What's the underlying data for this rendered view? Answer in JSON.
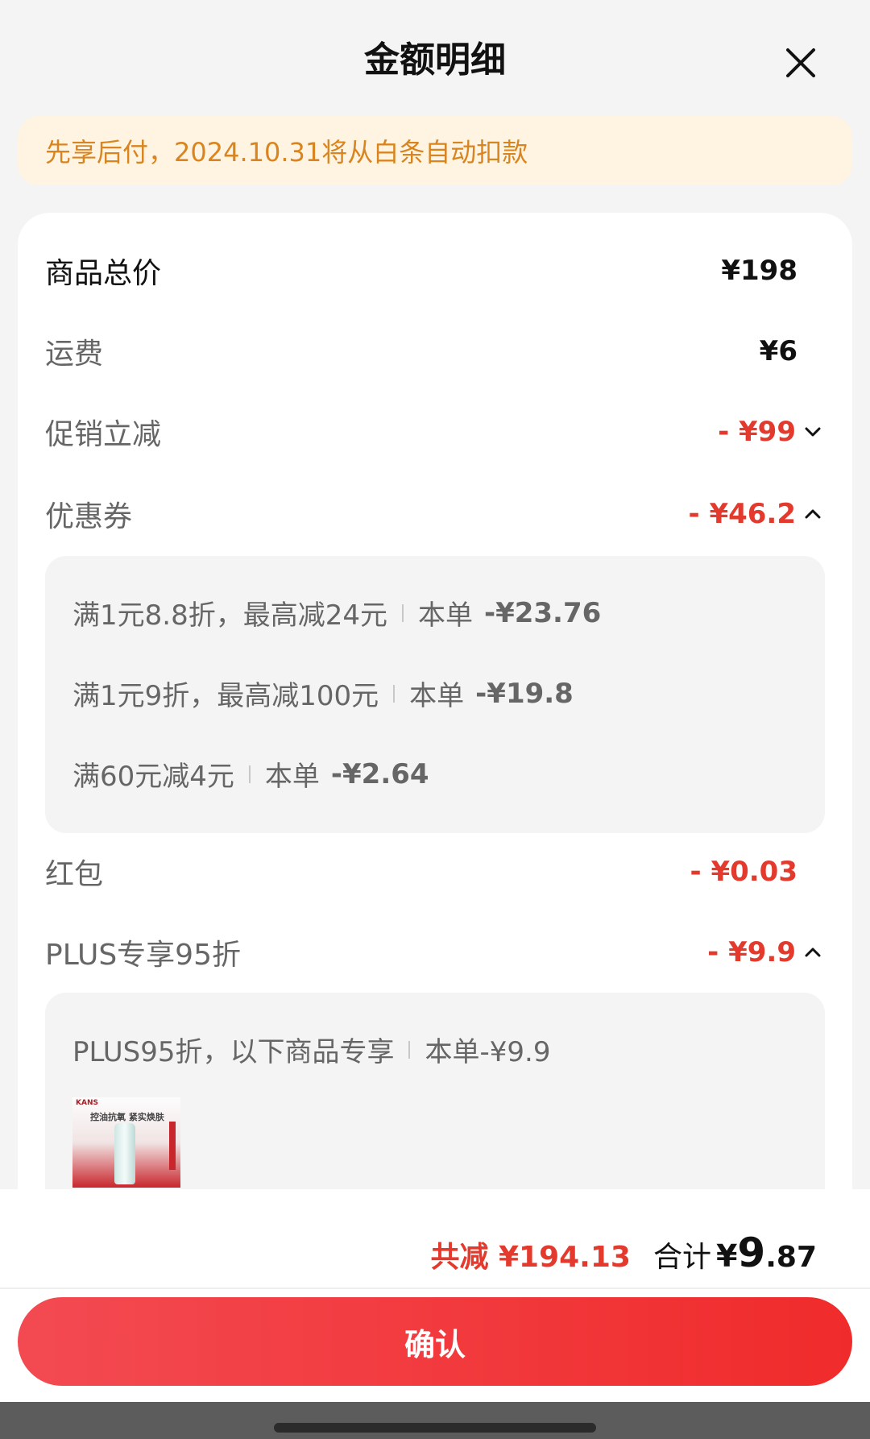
{
  "header": {
    "title": "金额明细"
  },
  "notice": {
    "text": "先享后付，2024.10.31将从白条自动扣款"
  },
  "rows": {
    "total_price": {
      "label": "商品总价",
      "value": "¥198"
    },
    "shipping": {
      "label": "运费",
      "value": "¥6"
    },
    "promotion": {
      "label": "促销立减",
      "value": "- ¥99"
    },
    "coupon": {
      "label": "优惠券",
      "value": "- ¥46.2"
    },
    "red_packet": {
      "label": "红包",
      "value": "- ¥0.03"
    },
    "plus": {
      "label": "PLUS专享95折",
      "value": "- ¥9.9"
    }
  },
  "coupons": [
    {
      "desc": "满1元8.8折，最高减24元",
      "order_label": "本单",
      "amount": "-¥23.76"
    },
    {
      "desc": "满1元9折，最高减100元",
      "order_label": "本单",
      "amount": "-¥19.8"
    },
    {
      "desc": "满60元减4元",
      "order_label": "本单",
      "amount": "-¥2.64"
    }
  ],
  "plus_detail": {
    "desc": "PLUS95折，以下商品专享",
    "order_amount": "本单-¥9.9"
  },
  "product": {
    "brand": "KANS",
    "tagline": "控油抗氧 紧实焕肤"
  },
  "summary": {
    "saved": "共减 ¥194.13",
    "total_label": "合计",
    "currency": "¥",
    "integer": "9",
    "decimal": ".87"
  },
  "confirm_label": "确认",
  "colors": {
    "red": "#e4392d",
    "notice_text": "#d9851f",
    "notice_bg": "#fff3e2"
  }
}
